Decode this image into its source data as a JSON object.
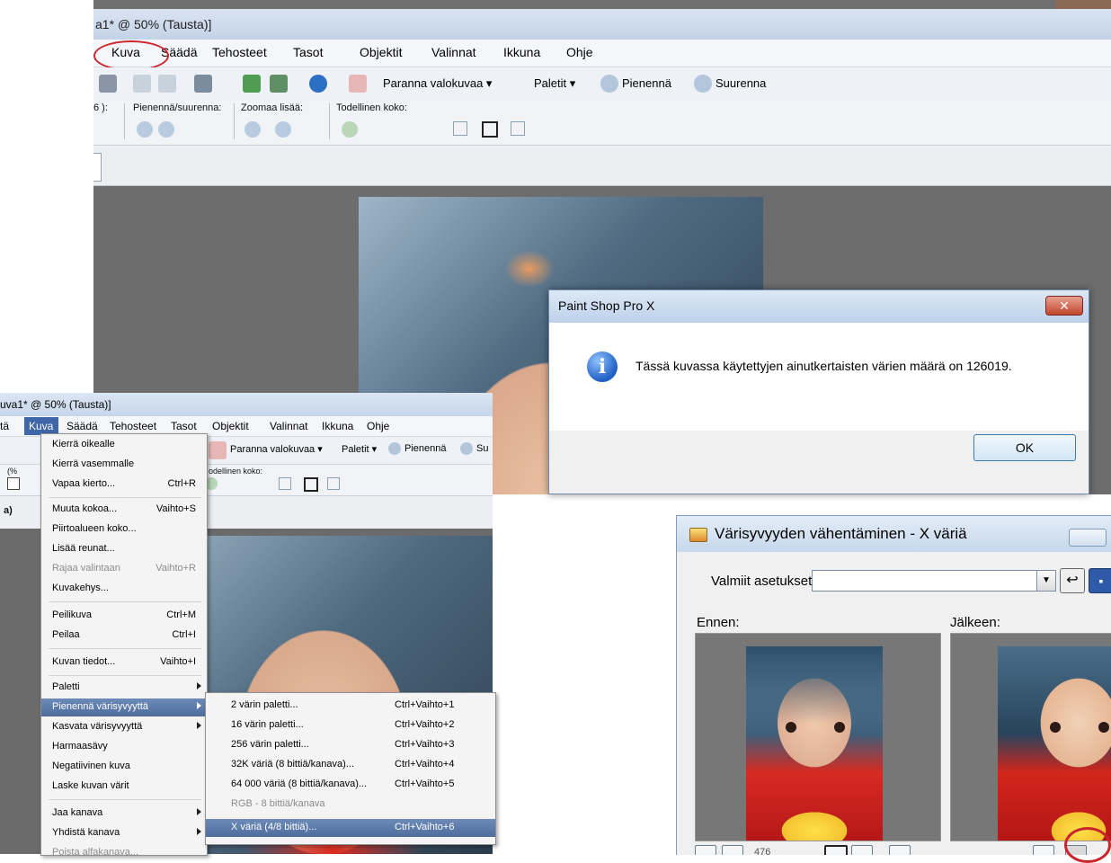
{
  "top_window": {
    "title": "a1* @ 50% (Tausta)]",
    "menu": [
      "Kuva",
      "Säädä",
      "Tehosteet",
      "Tasot",
      "Objektit",
      "Valinnat",
      "Ikkuna",
      "Ohje"
    ],
    "toolbar": {
      "enhance_label": "Paranna valokuvaa",
      "palettes_label": "Paletit",
      "zoom_out_label": "Pienennä",
      "zoom_in_label": "Suurenna"
    },
    "options": {
      "partial_label": "6 ):",
      "zoom_label": "Pienennä/suurenna:",
      "zoom_more_label": "Zoomaa lisää:",
      "actual_size_label": "Todellinen koko:"
    }
  },
  "psp_dialog": {
    "title": "Paint Shop Pro X",
    "close_glyph": "✕",
    "info_glyph": "i",
    "message": "Tässä kuvassa käytettyjen ainutkertaisten värien määrä on 126019.",
    "ok_label": "OK"
  },
  "bottom_left_window": {
    "title": "uva1* @ 50% (Tausta)]",
    "menu_partial": "tä",
    "menu": [
      "Kuva",
      "Säädä",
      "Tehosteet",
      "Tasot",
      "Objektit",
      "Valinnat",
      "Ikkuna",
      "Ohje"
    ],
    "toolbar": {
      "enhance_label": "Paranna valokuvaa",
      "palettes_label": "Paletit",
      "zoom_out_label": "Pienennä",
      "zoom_in_partial": "Su"
    },
    "options": {
      "partial_left": "(%",
      "actual_size_partial": "odellinen koko:",
      "strip_partial": "a)"
    }
  },
  "kuva_menu": {
    "items": [
      {
        "label": "Kierrä oikealle",
        "shortcut": "",
        "state": "normal"
      },
      {
        "label": "Kierrä vasemmalle",
        "shortcut": "",
        "state": "normal"
      },
      {
        "label": "Vapaa kierto...",
        "shortcut": "Ctrl+R",
        "state": "normal"
      },
      {
        "label": "Muuta kokoa...",
        "shortcut": "Vaihto+S",
        "state": "normal"
      },
      {
        "label": "Piirtoalueen koko...",
        "shortcut": "",
        "state": "normal"
      },
      {
        "label": "Lisää reunat...",
        "shortcut": "",
        "state": "normal"
      },
      {
        "label": "Rajaa valintaan",
        "shortcut": "Vaihto+R",
        "state": "disabled"
      },
      {
        "label": "Kuvakehys...",
        "shortcut": "",
        "state": "normal"
      },
      {
        "label": "Peilikuva",
        "shortcut": "Ctrl+M",
        "state": "normal"
      },
      {
        "label": "Peilaa",
        "shortcut": "Ctrl+I",
        "state": "normal"
      },
      {
        "label": "Kuvan tiedot...",
        "shortcut": "Vaihto+I",
        "state": "normal"
      },
      {
        "label": "Paletti",
        "shortcut": "",
        "state": "submenu"
      },
      {
        "label": "Pienennä värisyvyyttä",
        "shortcut": "",
        "state": "highlighted-submenu"
      },
      {
        "label": "Kasvata värisyvyyttä",
        "shortcut": "",
        "state": "submenu"
      },
      {
        "label": "Harmaasävy",
        "shortcut": "",
        "state": "normal"
      },
      {
        "label": "Negatiivinen kuva",
        "shortcut": "",
        "state": "normal"
      },
      {
        "label": "Laske kuvan värit",
        "shortcut": "",
        "state": "normal"
      },
      {
        "label": "Jaa kanava",
        "shortcut": "",
        "state": "submenu"
      },
      {
        "label": "Yhdistä kanava",
        "shortcut": "",
        "state": "submenu"
      },
      {
        "label": "Poista alfakanava...",
        "shortcut": "",
        "state": "disabled"
      }
    ]
  },
  "sub_menu": {
    "items": [
      {
        "label": "2 värin paletti...",
        "shortcut": "Ctrl+Vaihto+1",
        "state": "normal"
      },
      {
        "label": "16 värin paletti...",
        "shortcut": "Ctrl+Vaihto+2",
        "state": "normal"
      },
      {
        "label": "256 värin paletti...",
        "shortcut": "Ctrl+Vaihto+3",
        "state": "normal"
      },
      {
        "label": "32K väriä (8 bittiä/kanava)...",
        "shortcut": "Ctrl+Vaihto+4",
        "state": "normal"
      },
      {
        "label": "64 000 väriä (8 bittiä/kanava)...",
        "shortcut": "Ctrl+Vaihto+5",
        "state": "normal"
      },
      {
        "label": "RGB - 8 bittiä/kanava",
        "shortcut": "",
        "state": "disabled"
      },
      {
        "label": "X väriä (4/8 bittiä)...",
        "shortcut": "Ctrl+Vaihto+6",
        "state": "highlighted"
      }
    ]
  },
  "color_depth_dialog": {
    "title": "Värisyvyyden vähentäminen - X väriä",
    "preset_label": "Valmiit asetukset:",
    "preset_value": "",
    "before_label": "Ennen:",
    "after_label": "Jälkeen:",
    "zoom_partial": "476"
  },
  "colors": {
    "highlight": "#4e6c9c",
    "annotation_circle": "#c9252b",
    "close_button": "#c3452f"
  }
}
